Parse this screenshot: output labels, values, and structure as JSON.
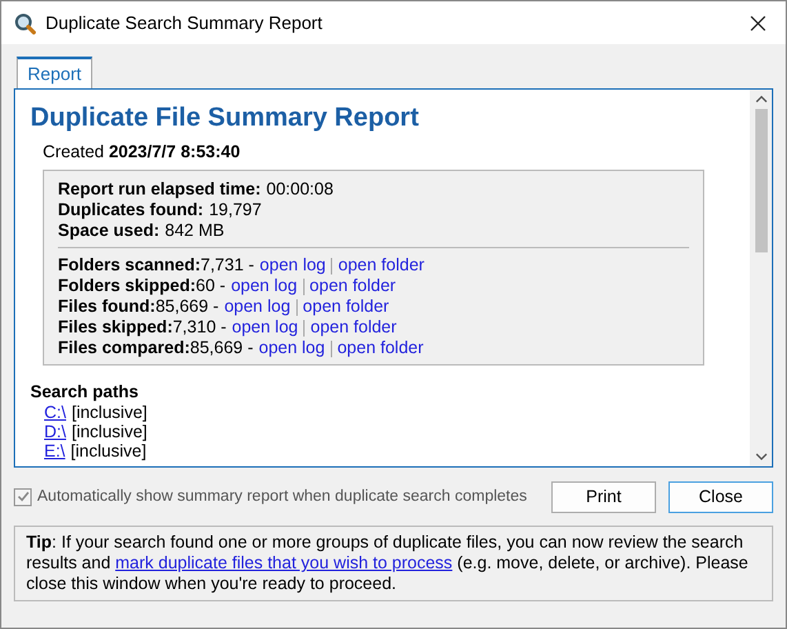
{
  "window": {
    "title": "Duplicate Search Summary Report"
  },
  "tabs": [
    {
      "label": "Report",
      "selected": true
    }
  ],
  "report": {
    "heading": "Duplicate File Summary Report",
    "created_label": "Created",
    "created_value": "2023/7/7 8:53:40",
    "summary": [
      {
        "label": "Report run elapsed time:",
        "value": "00:00:08"
      },
      {
        "label": "Duplicates found:",
        "value": "19,797"
      },
      {
        "label": "Space used:",
        "value": "842 MB"
      }
    ],
    "counts": [
      {
        "label": "Folders scanned:",
        "value": "7,731",
        "dash": "-",
        "open_log": "open log",
        "open_folder": "open folder"
      },
      {
        "label": "Folders skipped:",
        "value": "60",
        "dash": "-",
        "open_log": "open log",
        "open_folder": "open folder"
      },
      {
        "label": "Files found:",
        "value": "85,669",
        "dash": "-",
        "open_log": "open log",
        "open_folder": "open folder"
      },
      {
        "label": "Files skipped:",
        "value": "7,310",
        "dash": "-",
        "open_log": "open log",
        "open_folder": "open folder"
      },
      {
        "label": "Files compared:",
        "value": "85,669",
        "dash": "-",
        "open_log": "open log",
        "open_folder": "open folder"
      }
    ],
    "search_paths_heading": "Search paths",
    "search_paths": [
      {
        "path": "C:\\",
        "mode": "[inclusive]"
      },
      {
        "path": "D:\\",
        "mode": "[inclusive]"
      },
      {
        "path": "E:\\",
        "mode": "[inclusive]"
      }
    ]
  },
  "auto_show": {
    "label": "Automatically show summary report when duplicate search completes",
    "checked": true,
    "disabled": true
  },
  "buttons": [
    {
      "label": "Print",
      "selected": false
    },
    {
      "label": "Close",
      "selected": true
    }
  ],
  "tip": {
    "label": "Tip",
    "before": ": If your search found one or more groups of duplicate files, you can now review the search results and",
    "link": "mark duplicate files that you wish to process",
    "after": "(e.g. move, delete, or archive). Please close this window when you're ready to proceed."
  }
}
